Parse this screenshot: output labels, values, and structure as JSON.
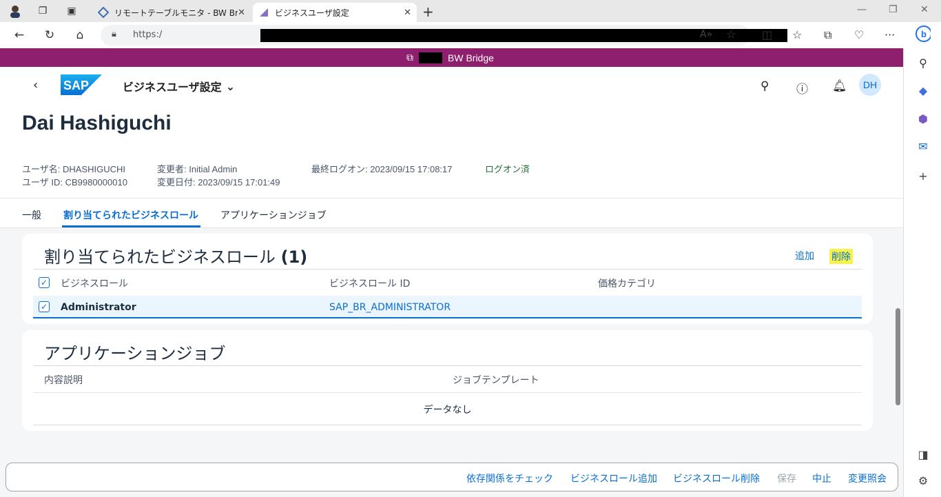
{
  "browser": {
    "tabs": [
      {
        "label": "リモートテーブルモニタ - BW Bridge (S",
        "active": false
      },
      {
        "label": "ビジネスユーザ設定",
        "active": true
      }
    ],
    "url_prefix": "https:/",
    "icons": {
      "back": "back-arrow-icon",
      "refresh": "refresh-icon",
      "home": "home-icon"
    }
  },
  "shell": {
    "product": "BW Bridge"
  },
  "app": {
    "title": "ビジネスユーザ設定",
    "user_initials": "DH",
    "object_title": "Dai Hashiguchi",
    "attributes": {
      "username": "ユーザ名: DHASHIGUCHI",
      "user_id": "ユーザ ID: CB9980000010",
      "changed_by": "変更者: Initial Admin",
      "changed_on": "変更日付: 2023/09/15 17:01:49",
      "last_logon": "最終ログオン: 2023/09/15 17:08:17",
      "logon_status": "ログオン済"
    },
    "tabs": [
      "一般",
      "割り当てられたビジネスロール",
      "アプリケーションジョブ"
    ],
    "roles_section": {
      "title": "割り当てられたビジネスロール",
      "count": "(1)",
      "add": "追加",
      "delete": "削除",
      "columns": [
        "ビジネスロール",
        "ビジネスロール ID",
        "価格カテゴリ"
      ],
      "rows": [
        {
          "role": "Administrator",
          "role_id": "SAP_BR_ADMINISTRATOR",
          "price": ""
        }
      ]
    },
    "jobs_section": {
      "title": "アプリケーションジョブ",
      "columns": [
        "内容説明",
        "ジョブテンプレート"
      ],
      "empty": "データなし"
    },
    "footer": {
      "check": "依存関係をチェック",
      "add_role": "ビジネスロール追加",
      "delete_role": "ビジネスロール削除",
      "save": "保存",
      "cancel": "中止",
      "history": "変更照会"
    }
  }
}
